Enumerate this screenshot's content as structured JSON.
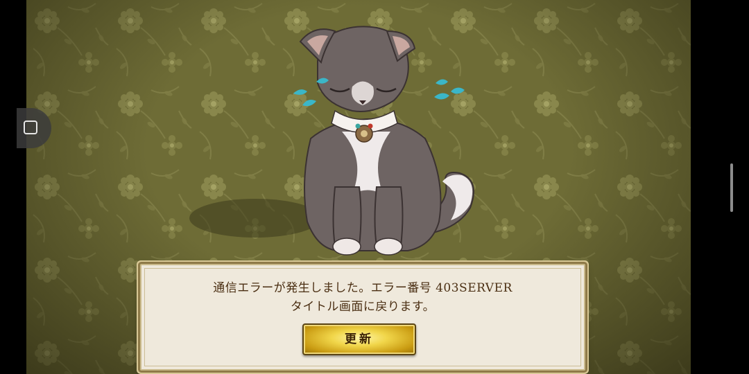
{
  "dialog": {
    "message_line1": "通信エラーが発生しました。エラー番号 403SERVER",
    "message_line2": "タイトル画面に戻ります。",
    "refresh_label": "更新"
  },
  "side_panel": {
    "icon": "square-icon"
  },
  "colors": {
    "wallpaper": "#6b6a35",
    "dialog_bg": "#efe9dc",
    "dialog_text": "#4a2e12",
    "button_gold": "#f1d64a"
  }
}
